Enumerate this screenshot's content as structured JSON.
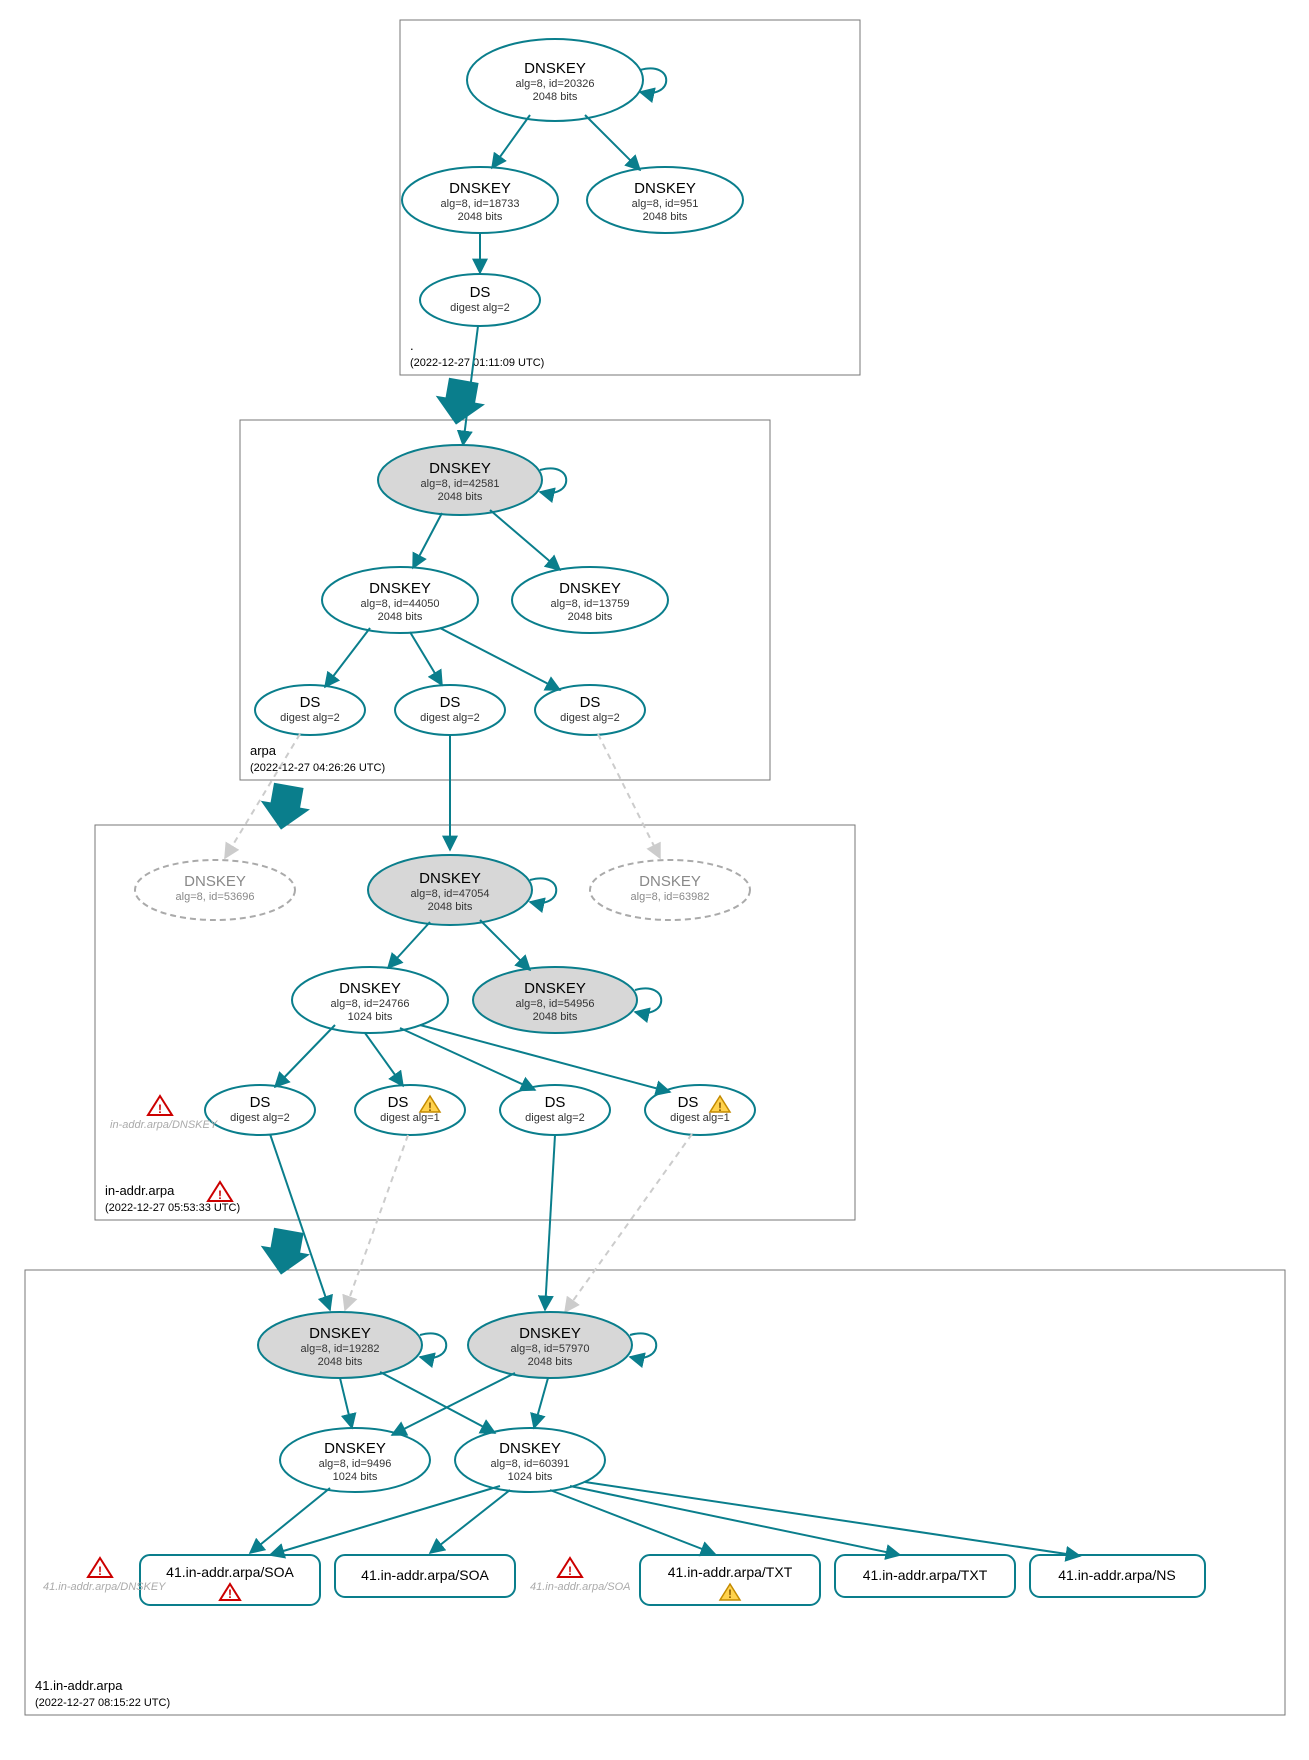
{
  "zones": {
    "root": {
      "name": ".",
      "ts": "(2022-12-27 01:11:09 UTC)"
    },
    "arpa": {
      "name": "arpa",
      "ts": "(2022-12-27 04:26:26 UTC)"
    },
    "inaddr": {
      "name": "in-addr.arpa",
      "ts": "(2022-12-27 05:53:33 UTC)"
    },
    "z41": {
      "name": "41.in-addr.arpa",
      "ts": "(2022-12-27 08:15:22 UTC)"
    }
  },
  "nodes": {
    "r_ksk": {
      "t": "DNSKEY",
      "l1": "alg=8, id=20326",
      "l2": "2048 bits"
    },
    "r_zsk1": {
      "t": "DNSKEY",
      "l1": "alg=8, id=18733",
      "l2": "2048 bits"
    },
    "r_zsk2": {
      "t": "DNSKEY",
      "l1": "alg=8, id=951",
      "l2": "2048 bits"
    },
    "r_ds": {
      "t": "DS",
      "l1": "digest alg=2"
    },
    "a_ksk": {
      "t": "DNSKEY",
      "l1": "alg=8, id=42581",
      "l2": "2048 bits"
    },
    "a_zsk1": {
      "t": "DNSKEY",
      "l1": "alg=8, id=44050",
      "l2": "2048 bits"
    },
    "a_zsk2": {
      "t": "DNSKEY",
      "l1": "alg=8, id=13759",
      "l2": "2048 bits"
    },
    "a_ds1": {
      "t": "DS",
      "l1": "digest alg=2"
    },
    "a_ds2": {
      "t": "DS",
      "l1": "digest alg=2"
    },
    "a_ds3": {
      "t": "DS",
      "l1": "digest alg=2"
    },
    "i_ghost1": {
      "t": "DNSKEY",
      "l1": "alg=8, id=53696"
    },
    "i_ksk": {
      "t": "DNSKEY",
      "l1": "alg=8, id=47054",
      "l2": "2048 bits"
    },
    "i_ghost2": {
      "t": "DNSKEY",
      "l1": "alg=8, id=63982"
    },
    "i_zsk": {
      "t": "DNSKEY",
      "l1": "alg=8, id=24766",
      "l2": "1024 bits"
    },
    "i_ksk2": {
      "t": "DNSKEY",
      "l1": "alg=8, id=54956",
      "l2": "2048 bits"
    },
    "i_ds1": {
      "t": "DS",
      "l1": "digest alg=2"
    },
    "i_ds2": {
      "t": "DS",
      "l1": "digest alg=1"
    },
    "i_ds3": {
      "t": "DS",
      "l1": "digest alg=2"
    },
    "i_ds4": {
      "t": "DS",
      "l1": "digest alg=1"
    },
    "z_k1": {
      "t": "DNSKEY",
      "l1": "alg=8, id=19282",
      "l2": "2048 bits"
    },
    "z_k2": {
      "t": "DNSKEY",
      "l1": "alg=8, id=57970",
      "l2": "2048 bits"
    },
    "z_k3": {
      "t": "DNSKEY",
      "l1": "alg=8, id=9496",
      "l2": "1024 bits"
    },
    "z_k4": {
      "t": "DNSKEY",
      "l1": "alg=8, id=60391",
      "l2": "1024 bits"
    },
    "rr_soa1": {
      "t": "41.in-addr.arpa/SOA"
    },
    "rr_soa2": {
      "t": "41.in-addr.arpa/SOA"
    },
    "rr_txt1": {
      "t": "41.in-addr.arpa/TXT"
    },
    "rr_txt2": {
      "t": "41.in-addr.arpa/TXT"
    },
    "rr_ns": {
      "t": "41.in-addr.arpa/NS"
    }
  },
  "ghosts": {
    "g1": "in-addr.arpa/DNSKEY",
    "g2": "41.in-addr.arpa/DNSKEY",
    "g3": "41.in-addr.arpa/SOA"
  }
}
